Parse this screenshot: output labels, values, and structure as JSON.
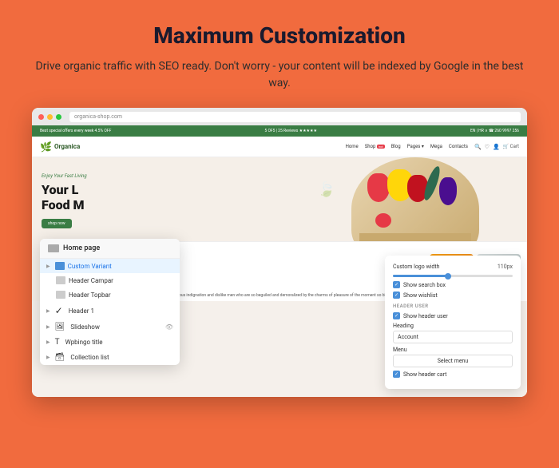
{
  "page": {
    "background_color": "#F16B3E",
    "headline": "Maximum Customization",
    "subheadline": "Drive organic traffic with SEO ready.  Don't worry - your content will be indexed by Google in the best way."
  },
  "browser": {
    "url_bar_text": "organica-shop.com"
  },
  "site": {
    "topbar_text": "Best special offers every week 4.5% OFF",
    "topbar_reviews": "5 OF5 | 25 Reviews",
    "logo": "Organica",
    "nav_links": [
      "Home",
      "Shop",
      "Blog",
      "Pages",
      "Mega",
      "Contacts"
    ],
    "hero_tag": "Enjoy Your Fast Living",
    "hero_title_line1": "Your L",
    "hero_title_line2": "Food M",
    "hero_btn": "shop now"
  },
  "panel": {
    "logo_width_label": "Custom logo width",
    "logo_width_value": "110px",
    "search_box_label": "Show search box",
    "wishlist_label": "Show wishlist",
    "section_header_user": "HEADER USER",
    "show_header_user_label": "Show header user",
    "heading_label": "Heading",
    "heading_value": "Account",
    "menu_label": "Menu",
    "menu_btn": "Select menu",
    "show_cart_label": "Show header cart"
  },
  "sidebar": {
    "title": "Home page",
    "items": [
      {
        "label": "Custom Variant",
        "type": "active",
        "indent": false
      },
      {
        "label": "Header Campar",
        "type": "normal",
        "indent": true
      },
      {
        "label": "Header Topbar",
        "type": "normal",
        "indent": true
      },
      {
        "label": "Header 1",
        "type": "normal",
        "indent": false
      },
      {
        "label": "Slideshow",
        "type": "normal",
        "indent": false,
        "has_eye": true
      },
      {
        "label": "Wpbingo title",
        "type": "normal",
        "indent": false
      },
      {
        "label": "Collection list",
        "type": "normal",
        "indent": false
      }
    ]
  }
}
